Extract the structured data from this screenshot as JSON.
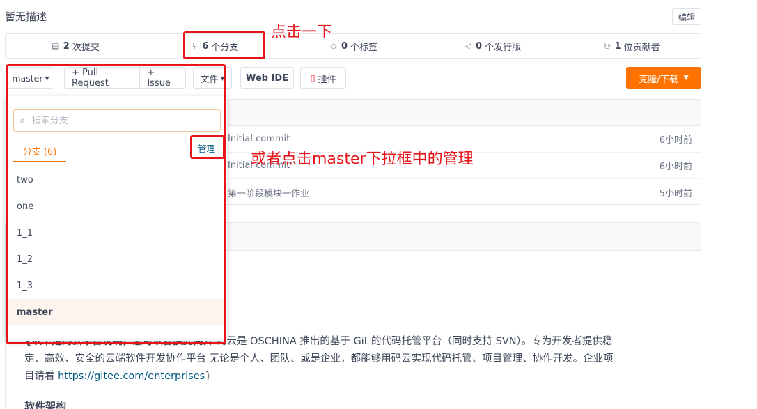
{
  "repo": {
    "description": "暂无描述",
    "edit_label": "编辑"
  },
  "stats": [
    {
      "icon": "commit-icon",
      "count": "2",
      "label": "次提交"
    },
    {
      "icon": "branch-icon",
      "count": "6",
      "label": "个分支"
    },
    {
      "icon": "tag-icon",
      "count": "0",
      "label": "个标签"
    },
    {
      "icon": "release-icon",
      "count": "0",
      "label": "个发行版"
    },
    {
      "icon": "contributor-icon",
      "count": "1",
      "label": "位贡献者"
    }
  ],
  "toolbar": {
    "branch_selected": "master",
    "pull_request": "+ Pull Request",
    "issue": "+ Issue",
    "file": "文件",
    "web_ide": "Web IDE",
    "widget": "挂件",
    "clone": "克隆/下载"
  },
  "commits": [
    {
      "message": "Initial commit",
      "time": "6小时前"
    },
    {
      "message": "Initial commit",
      "time": "6小时前"
    },
    {
      "message": "第一阶段模块一作业",
      "time": "5小时前"
    }
  ],
  "branch_dropdown": {
    "search_placeholder": "搜索分支",
    "tab_label": "分支 (6)",
    "manage_label": "管理",
    "branches": [
      "two",
      "one",
      "1_1",
      "1_2",
      "1_3",
      "master"
    ]
  },
  "readme": {
    "bold_intro": "{以下是码云平台说明，您可以替换此简介",
    "line1_rest": " 码云是 OSCHINA 推出的基于 Git 的代码托管平台（同时支持 SVN）。专为开发者提供稳",
    "line2": "定、高效、安全的云端软件开发协作平台 无论是个人、团队、或是企业，都能够用码云实现代码托管、项目管理、协作开发。企业项",
    "line3_prefix": "目请看 ",
    "line3_link": "https://gitee.com/enterprises",
    "line3_suffix": "}",
    "section_heading": "软件架构"
  },
  "annotations": {
    "click_once": "点击一下",
    "or_click": "或者点击master下拉框中的管理"
  },
  "colors": {
    "accent": "#fe7300",
    "annotation_red": "#e5151b",
    "link": "#005980"
  }
}
